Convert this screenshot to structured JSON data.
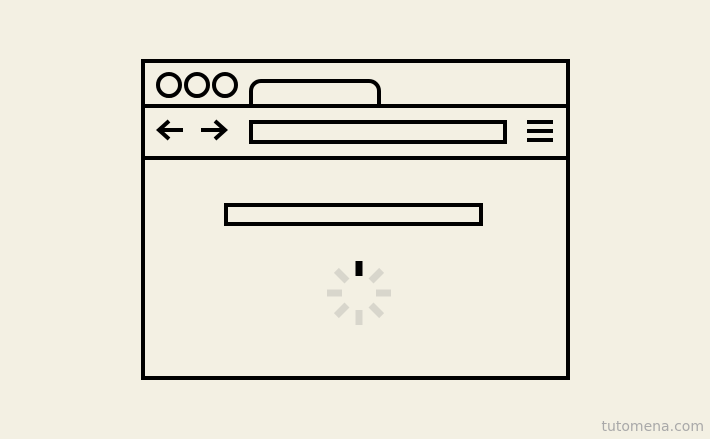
{
  "browser": {
    "window_buttons": [
      "window-button",
      "window-button",
      "window-button"
    ],
    "icons": {
      "back": "back-arrow-icon",
      "forward": "forward-arrow-icon",
      "menu": "hamburger-menu-icon",
      "loading": "loading-spinner-icon"
    }
  },
  "watermark": "tutomena.com",
  "colors": {
    "background": "#f3f0e3",
    "stroke": "#000000",
    "spinner_faded": "#d8d6cc",
    "watermark": "#a9a9a9"
  }
}
